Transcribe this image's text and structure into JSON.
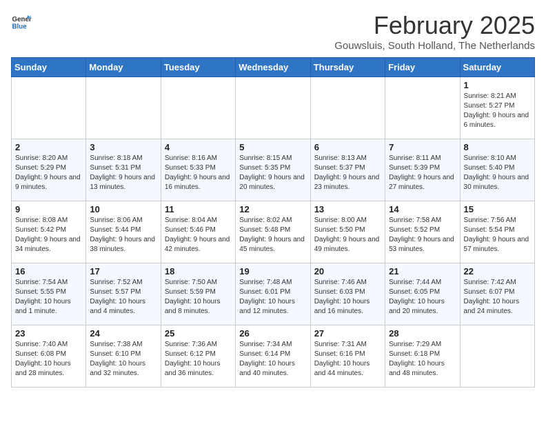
{
  "header": {
    "logo_general": "General",
    "logo_blue": "Blue",
    "title": "February 2025",
    "subtitle": "Gouwsluis, South Holland, The Netherlands"
  },
  "weekdays": [
    "Sunday",
    "Monday",
    "Tuesday",
    "Wednesday",
    "Thursday",
    "Friday",
    "Saturday"
  ],
  "weeks": [
    [
      {
        "day": "",
        "info": ""
      },
      {
        "day": "",
        "info": ""
      },
      {
        "day": "",
        "info": ""
      },
      {
        "day": "",
        "info": ""
      },
      {
        "day": "",
        "info": ""
      },
      {
        "day": "",
        "info": ""
      },
      {
        "day": "1",
        "info": "Sunrise: 8:21 AM\nSunset: 5:27 PM\nDaylight: 9 hours and 6 minutes."
      }
    ],
    [
      {
        "day": "2",
        "info": "Sunrise: 8:20 AM\nSunset: 5:29 PM\nDaylight: 9 hours and 9 minutes."
      },
      {
        "day": "3",
        "info": "Sunrise: 8:18 AM\nSunset: 5:31 PM\nDaylight: 9 hours and 13 minutes."
      },
      {
        "day": "4",
        "info": "Sunrise: 8:16 AM\nSunset: 5:33 PM\nDaylight: 9 hours and 16 minutes."
      },
      {
        "day": "5",
        "info": "Sunrise: 8:15 AM\nSunset: 5:35 PM\nDaylight: 9 hours and 20 minutes."
      },
      {
        "day": "6",
        "info": "Sunrise: 8:13 AM\nSunset: 5:37 PM\nDaylight: 9 hours and 23 minutes."
      },
      {
        "day": "7",
        "info": "Sunrise: 8:11 AM\nSunset: 5:39 PM\nDaylight: 9 hours and 27 minutes."
      },
      {
        "day": "8",
        "info": "Sunrise: 8:10 AM\nSunset: 5:40 PM\nDaylight: 9 hours and 30 minutes."
      }
    ],
    [
      {
        "day": "9",
        "info": "Sunrise: 8:08 AM\nSunset: 5:42 PM\nDaylight: 9 hours and 34 minutes."
      },
      {
        "day": "10",
        "info": "Sunrise: 8:06 AM\nSunset: 5:44 PM\nDaylight: 9 hours and 38 minutes."
      },
      {
        "day": "11",
        "info": "Sunrise: 8:04 AM\nSunset: 5:46 PM\nDaylight: 9 hours and 42 minutes."
      },
      {
        "day": "12",
        "info": "Sunrise: 8:02 AM\nSunset: 5:48 PM\nDaylight: 9 hours and 45 minutes."
      },
      {
        "day": "13",
        "info": "Sunrise: 8:00 AM\nSunset: 5:50 PM\nDaylight: 9 hours and 49 minutes."
      },
      {
        "day": "14",
        "info": "Sunrise: 7:58 AM\nSunset: 5:52 PM\nDaylight: 9 hours and 53 minutes."
      },
      {
        "day": "15",
        "info": "Sunrise: 7:56 AM\nSunset: 5:54 PM\nDaylight: 9 hours and 57 minutes."
      }
    ],
    [
      {
        "day": "16",
        "info": "Sunrise: 7:54 AM\nSunset: 5:55 PM\nDaylight: 10 hours and 1 minute."
      },
      {
        "day": "17",
        "info": "Sunrise: 7:52 AM\nSunset: 5:57 PM\nDaylight: 10 hours and 4 minutes."
      },
      {
        "day": "18",
        "info": "Sunrise: 7:50 AM\nSunset: 5:59 PM\nDaylight: 10 hours and 8 minutes."
      },
      {
        "day": "19",
        "info": "Sunrise: 7:48 AM\nSunset: 6:01 PM\nDaylight: 10 hours and 12 minutes."
      },
      {
        "day": "20",
        "info": "Sunrise: 7:46 AM\nSunset: 6:03 PM\nDaylight: 10 hours and 16 minutes."
      },
      {
        "day": "21",
        "info": "Sunrise: 7:44 AM\nSunset: 6:05 PM\nDaylight: 10 hours and 20 minutes."
      },
      {
        "day": "22",
        "info": "Sunrise: 7:42 AM\nSunset: 6:07 PM\nDaylight: 10 hours and 24 minutes."
      }
    ],
    [
      {
        "day": "23",
        "info": "Sunrise: 7:40 AM\nSunset: 6:08 PM\nDaylight: 10 hours and 28 minutes."
      },
      {
        "day": "24",
        "info": "Sunrise: 7:38 AM\nSunset: 6:10 PM\nDaylight: 10 hours and 32 minutes."
      },
      {
        "day": "25",
        "info": "Sunrise: 7:36 AM\nSunset: 6:12 PM\nDaylight: 10 hours and 36 minutes."
      },
      {
        "day": "26",
        "info": "Sunrise: 7:34 AM\nSunset: 6:14 PM\nDaylight: 10 hours and 40 minutes."
      },
      {
        "day": "27",
        "info": "Sunrise: 7:31 AM\nSunset: 6:16 PM\nDaylight: 10 hours and 44 minutes."
      },
      {
        "day": "28",
        "info": "Sunrise: 7:29 AM\nSunset: 6:18 PM\nDaylight: 10 hours and 48 minutes."
      },
      {
        "day": "",
        "info": ""
      }
    ]
  ]
}
